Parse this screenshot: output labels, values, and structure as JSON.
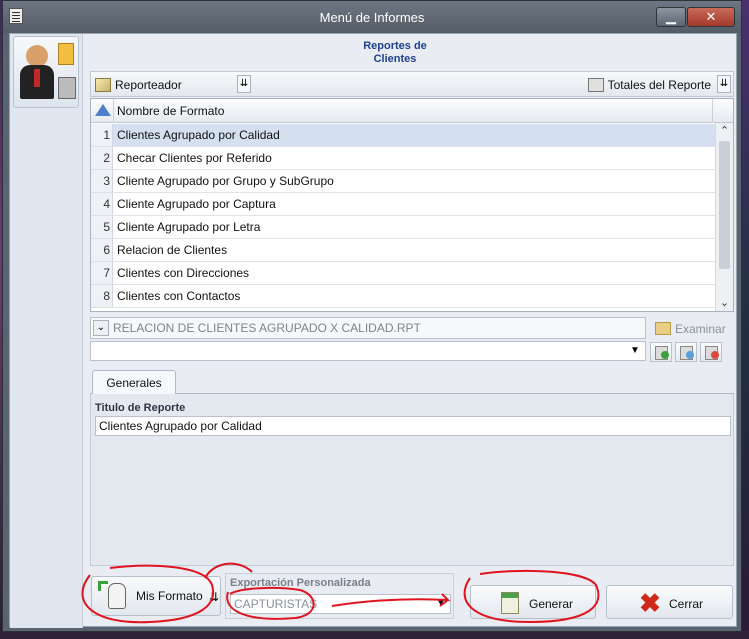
{
  "window": {
    "title": "Menú de Informes",
    "min_label": "▁",
    "close_label": "✕"
  },
  "header": {
    "title": "Reportes de Clientes"
  },
  "toolbar": {
    "left_label": "Reporteador",
    "right_label": "Totales del Reporte",
    "arrow": "⇊"
  },
  "grid": {
    "column": "Nombre de Formato",
    "rows": [
      {
        "n": "1",
        "name": "Clientes Agrupado por Calidad"
      },
      {
        "n": "2",
        "name": "Checar Clientes por Referido"
      },
      {
        "n": "3",
        "name": "Cliente Agrupado por Grupo y SubGrupo"
      },
      {
        "n": "4",
        "name": "Cliente Agrupado por Captura"
      },
      {
        "n": "5",
        "name": "Cliente Agrupado por Letra"
      },
      {
        "n": "6",
        "name": "Relacion de Clientes"
      },
      {
        "n": "7",
        "name": "Clientes con Direcciones"
      },
      {
        "n": "8",
        "name": "Clientes con Contactos"
      }
    ],
    "scroll_up": "⌃",
    "scroll_down": "⌄"
  },
  "file": {
    "path": "RELACION DE CLIENTES AGRUPADO X CALIDAD.RPT",
    "chevron": "⌄",
    "browse_label": "Examinar"
  },
  "combo": {
    "arrow": "▼"
  },
  "tabs": {
    "general": "Generales"
  },
  "form": {
    "title_label": "Titulo de Reporte",
    "title_value": "Clientes Agrupado por Calidad"
  },
  "footer": {
    "mis_formato": "Mis Formato",
    "mis_arrow": "⇊",
    "export_label": "Exportación Personalizada",
    "export_value": "CAPTURISTAS",
    "export_arrow": "▼",
    "generar": "Generar",
    "cerrar": "Cerrar",
    "close_glyph": "✖"
  },
  "colors": {
    "annotation": "#e0141e",
    "accent": "#1f3f8f"
  }
}
